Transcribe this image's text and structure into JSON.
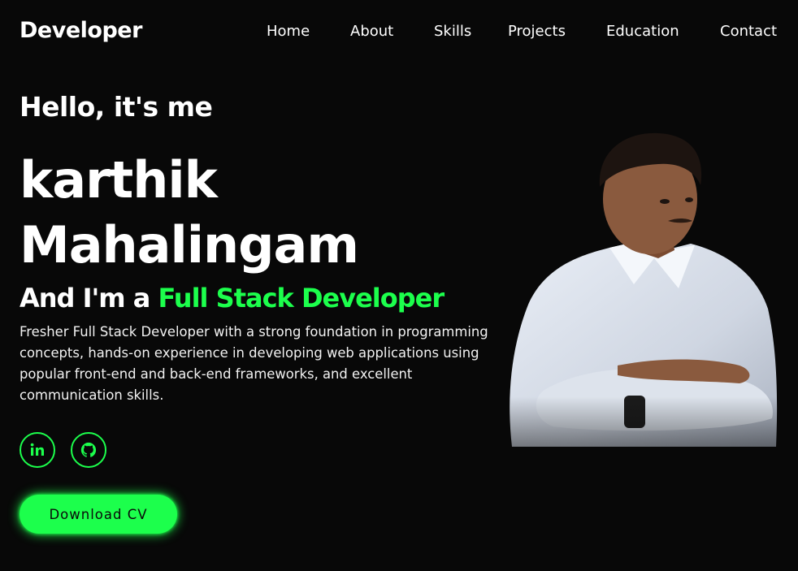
{
  "header": {
    "logo": "Developer",
    "nav": [
      {
        "label": "Home"
      },
      {
        "label": "About"
      },
      {
        "label": "Skills"
      },
      {
        "label": "Projects"
      },
      {
        "label": "Education"
      },
      {
        "label": "Contact"
      }
    ]
  },
  "hero": {
    "greeting": "Hello, it's me",
    "name_line1": "karthik",
    "name_line2": "Mahalingam",
    "role_prefix": "And I'm a",
    "role_highlight": "Full Stack Developer",
    "description": "Fresher Full Stack Developer with a strong foundation in programming concepts, hands-on experience in developing web applications using popular front-end and back-end frameworks, and excellent communication skills.",
    "social": [
      {
        "icon": "linkedin-icon"
      },
      {
        "icon": "github-icon"
      }
    ],
    "cv_button": "Download CV"
  },
  "colors": {
    "background": "#080808",
    "accent": "#1cff4c",
    "text": "#ffffff"
  }
}
